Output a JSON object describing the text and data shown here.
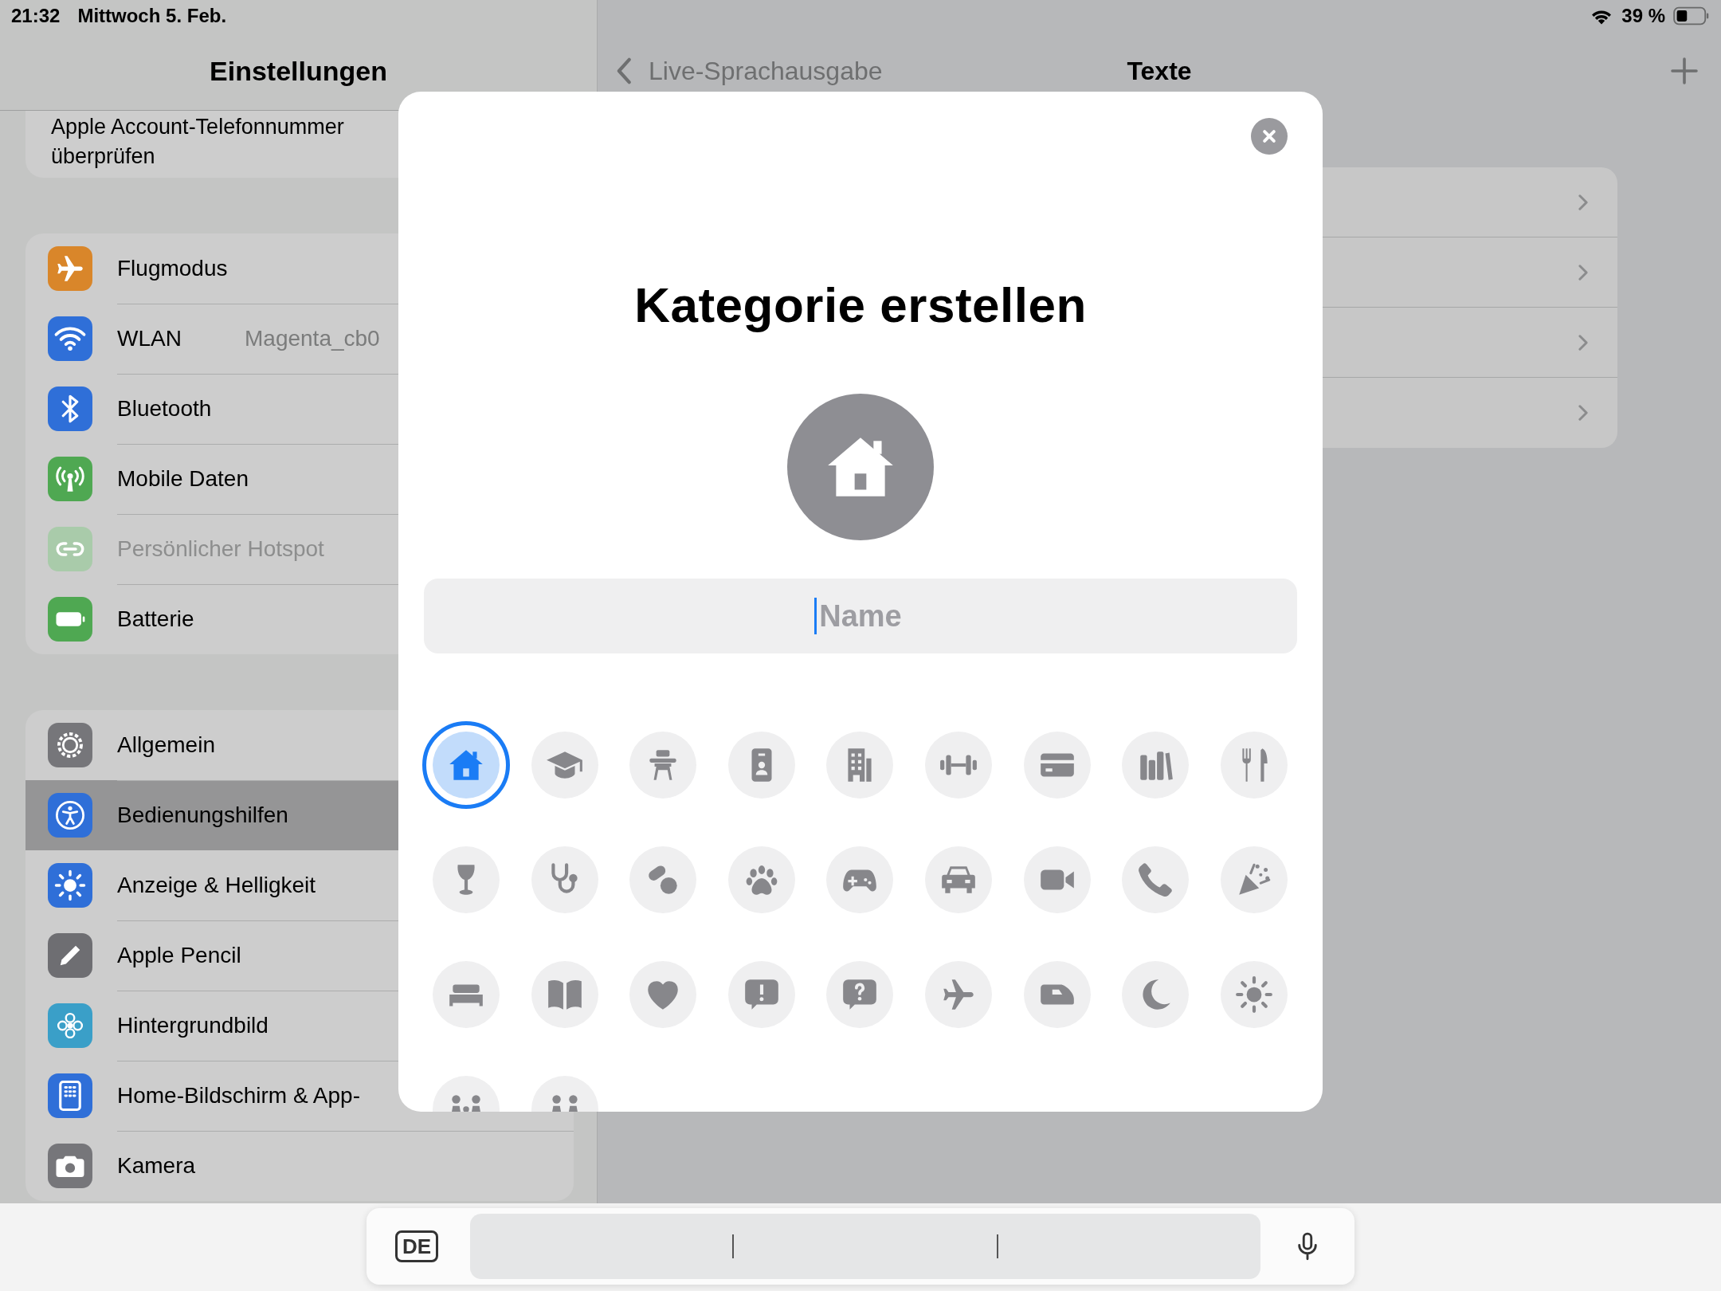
{
  "status_bar": {
    "time": "21:32",
    "date": "Mittwoch 5. Feb.",
    "battery": "39 %"
  },
  "sidebar": {
    "title": "Einstellungen",
    "notice": "Apple Account-Telefonnummer überprüfen",
    "groups": [
      [
        {
          "label": "Flugmodus",
          "kind": "airplane",
          "color": "#d9862a",
          "selected": false,
          "disabled": false
        },
        {
          "label": "WLAN",
          "value": "Magenta_cb0",
          "kind": "wifi",
          "color": "#2f6fd8",
          "selected": false,
          "disabled": false
        },
        {
          "label": "Bluetooth",
          "kind": "bluetooth",
          "color": "#2f6fd8",
          "selected": false,
          "disabled": false
        },
        {
          "label": "Mobile Daten",
          "kind": "antenna",
          "color": "#4fa852",
          "selected": false,
          "disabled": false
        },
        {
          "label": "Persönlicher Hotspot",
          "kind": "chain",
          "color": "#a9cbaa",
          "selected": false,
          "disabled": true
        },
        {
          "label": "Batterie",
          "kind": "battery",
          "color": "#4fa852",
          "selected": false,
          "disabled": false
        }
      ],
      [
        {
          "label": "Allgemein",
          "kind": "gear",
          "color": "#76767a",
          "selected": false,
          "disabled": false
        },
        {
          "label": "Bedienungshilfen",
          "kind": "access",
          "color": "#2f6fd8",
          "selected": true,
          "disabled": false
        },
        {
          "label": "Anzeige & Helligkeit",
          "kind": "sun",
          "color": "#2f6fd8",
          "selected": false,
          "disabled": false
        },
        {
          "label": "Apple Pencil",
          "kind": "pencil",
          "color": "#6e6e72",
          "selected": false,
          "disabled": false
        },
        {
          "label": "Hintergrundbild",
          "kind": "flower",
          "color": "#3a9fc8",
          "selected": false,
          "disabled": false
        },
        {
          "label": "Home-Bildschirm & App-",
          "kind": "homescreen",
          "color": "#2f6fd8",
          "selected": false,
          "disabled": false
        },
        {
          "label": "Kamera",
          "kind": "camera",
          "color": "#76767a",
          "selected": false,
          "disabled": false
        }
      ]
    ]
  },
  "detail": {
    "back_label": "Live-Sprachausgabe",
    "title": "Texte"
  },
  "dialog": {
    "title": "Kategorie erstellen",
    "preview": {
      "kind": "house"
    },
    "name_field": {
      "placeholder": "Name"
    },
    "icons": [
      {
        "kind": "house",
        "selected": true
      },
      {
        "kind": "gradcap",
        "selected": false
      },
      {
        "kind": "desk",
        "selected": false
      },
      {
        "kind": "badge",
        "selected": false
      },
      {
        "kind": "building",
        "selected": false
      },
      {
        "kind": "dumbbell",
        "selected": false
      },
      {
        "kind": "card",
        "selected": false
      },
      {
        "kind": "books",
        "selected": false
      },
      {
        "kind": "cutlery",
        "selected": false
      },
      {
        "kind": "wineglass",
        "selected": false
      },
      {
        "kind": "stethoscope",
        "selected": false
      },
      {
        "kind": "pills",
        "selected": false
      },
      {
        "kind": "paw",
        "selected": false
      },
      {
        "kind": "gamepad",
        "selected": false
      },
      {
        "kind": "car",
        "selected": false
      },
      {
        "kind": "video",
        "selected": false
      },
      {
        "kind": "phone",
        "selected": false
      },
      {
        "kind": "party",
        "selected": false
      },
      {
        "kind": "bed",
        "selected": false
      },
      {
        "kind": "book",
        "selected": false
      },
      {
        "kind": "heart",
        "selected": false
      },
      {
        "kind": "exclaim",
        "selected": false
      },
      {
        "kind": "question",
        "selected": false
      },
      {
        "kind": "airplane",
        "selected": false
      },
      {
        "kind": "train",
        "selected": false
      },
      {
        "kind": "moon",
        "selected": false
      },
      {
        "kind": "sun",
        "selected": false
      },
      {
        "kind": "family",
        "selected": false
      },
      {
        "kind": "pair",
        "selected": false
      }
    ]
  },
  "keyboard_bar": {
    "language_key": "DE"
  }
}
